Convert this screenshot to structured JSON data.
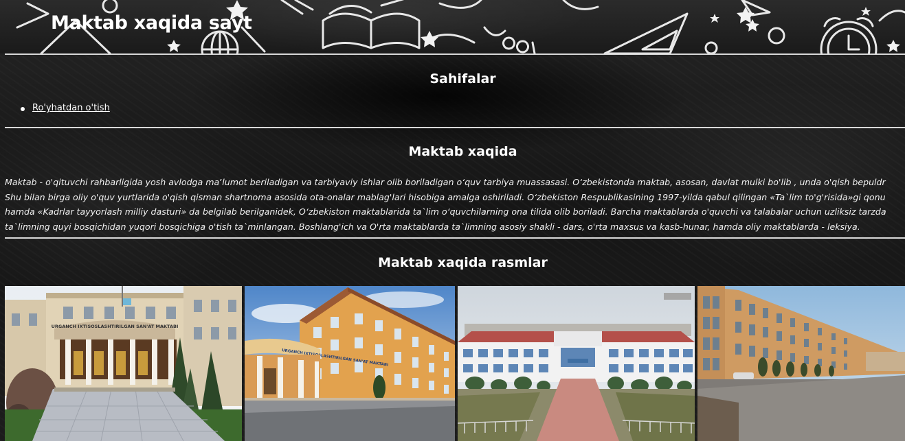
{
  "header": {
    "title": "Maktab xaqida sayt",
    "decorations": [
      "star-icon",
      "book-icon",
      "triangle-ruler-icon",
      "alarm-clock-icon",
      "globe-icon",
      "circle-icon"
    ]
  },
  "pages_section": {
    "title": "Sahifalar",
    "links": [
      {
        "label": "Ro'yhatdan o'tish"
      }
    ]
  },
  "about_section": {
    "title": "Maktab xaqida",
    "lines": [
      "Maktab - o'qituvchi rahbarligida yosh avlodga maʼlumot beriladigan va tarbiyaviy ishlar olib boriladigan oʻquv tarbiya muassasasi. Oʻzbekistonda maktab, asosan, davlat mulki bo'lib , unda o'qish bepuldr",
      "Shu bilan birga oliy o'quv yurtlarida o'qish qisman shartnoma asosida ota-onalar mablag'lari hisobiga amalga oshiriladi. Oʻzbekiston Respublikasining 1997-yilda qabul qilingan «Ta`lim to'g'risida»gi qonu",
      "hamda «Kadrlar tayyorlash milliy dasturi» da belgilab berilganidek, Oʻzbekiston maktablarida ta`lim oʻquvchilarning ona tilida olib boriladi. Barcha maktablarda o'quvchi va talabalar uchun uzliksiz tarzda",
      "ta`limning quyi bosqichidan yuqori bosqichiga o'tish ta`minlangan. Boshlang'ich va O'rta maktablarda ta`limning asosiy shakli - dars, o'rta maxsus va kasb-hunar, hamda oliy maktablarda - leksiya."
    ]
  },
  "photos_section": {
    "title": "Maktab xaqida rasmlar",
    "photos": [
      {
        "sign_text": "URGANCH IXTISOSLASHTIRILGAN SAN'AT MAKTABI"
      },
      {
        "sign_text": "URGANCH IXTISOSLASHTIRILGAN SAN'AT MAKTABI"
      },
      {
        "sign_text": ""
      },
      {
        "sign_text": ""
      }
    ]
  },
  "colors": {
    "background": "#1a1a1a",
    "text": "#ffffff",
    "rule": "#d9d9d9"
  }
}
